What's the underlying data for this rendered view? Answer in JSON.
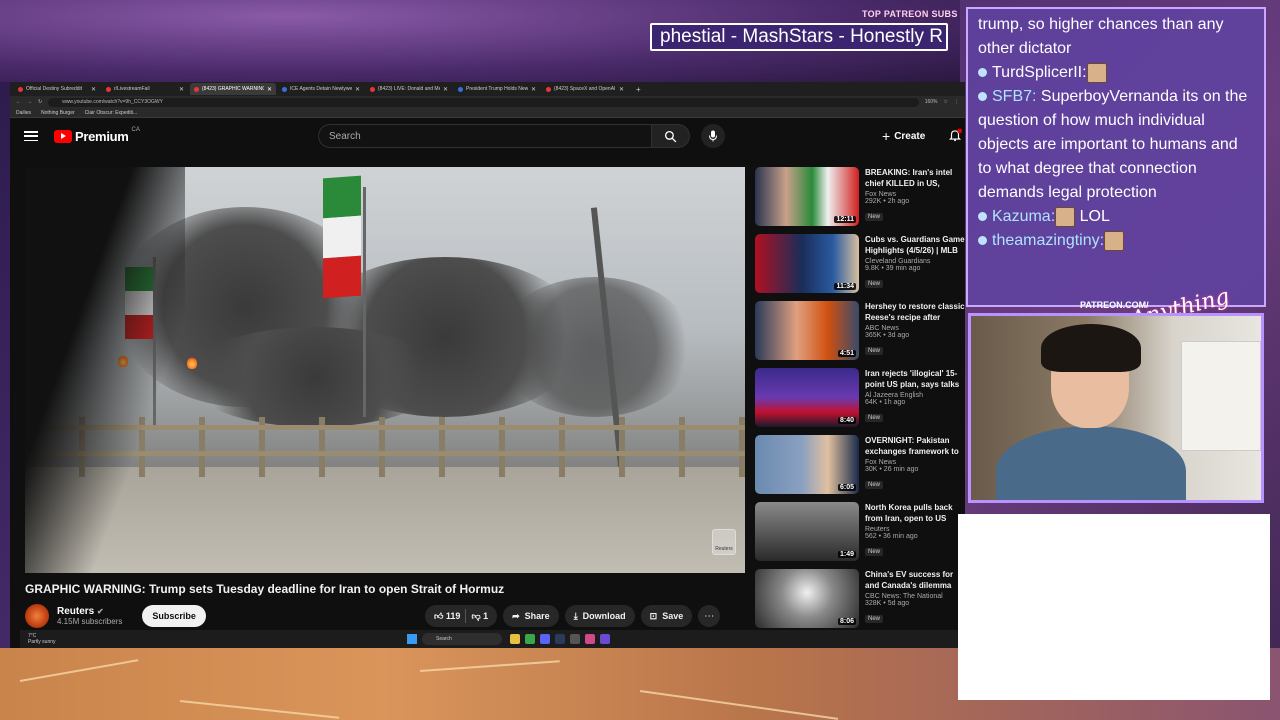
{
  "stream": {
    "patreon_label": "TOP PATREON SUBS",
    "ticker_text": "phestial - MashStars - Honestly R",
    "patreon_url": "PATREON.COM/",
    "script_logo": "Anything Else"
  },
  "browser": {
    "tabs": [
      {
        "label": "Official Destiny Subreddit",
        "active": false
      },
      {
        "label": "r/LivestreamFail",
        "active": false
      },
      {
        "label": "(8423) GRAPHIC WARNING",
        "active": true
      },
      {
        "label": "ICE Agents Detain Newlywed S",
        "active": false
      },
      {
        "label": "(8423) LIVE: Donald and Melan",
        "active": false
      },
      {
        "label": "President Trump Holds News C",
        "active": false
      },
      {
        "label": "(8423) SpaceX and OpenAI",
        "active": false
      }
    ],
    "url": "www.youtube.com/watch?v=9h_CCY3OGWY",
    "zoom": "160%",
    "bookmarks": [
      "Dailies",
      "Nothing Burger",
      "Clair Obscur: Expediti..."
    ]
  },
  "youtube": {
    "logo_text": "Premium",
    "logo_region": "CA",
    "search_placeholder": "Search",
    "create_label": "Create",
    "notification_count": "9+",
    "video_title": "GRAPHIC WARNING: Trump sets Tuesday deadline for Iran to open Strait of Hormuz",
    "channel_name": "Reuters",
    "channel_subs": "4.15M subscribers",
    "subscribe_label": "Subscribe",
    "like_count": "119",
    "dislike_count": "1",
    "share_label": "Share",
    "download_label": "Download",
    "save_label": "Save",
    "watermark": "Reuters"
  },
  "recommendations": [
    {
      "title": "BREAKING: Iran's intel chief KILLED in US, Israeli strikes",
      "source": "Fox News",
      "meta": "292K • 2h ago",
      "badge": "New",
      "duration": "12:11"
    },
    {
      "title": "Cubs vs. Guardians Game Highlights (4/5/26) | MLB",
      "source": "Cleveland Guardians",
      "meta": "9.8K • 39 min ago",
      "badge": "New",
      "duration": "11:34"
    },
    {
      "title": "Hershey to restore classic Reese's recipe after criticism",
      "source": "ABC News",
      "meta": "365K • 3d ago",
      "badge": "New",
      "duration": "4:51"
    },
    {
      "title": "Iran rejects 'illogical' 15-point US plan, says talks cannot",
      "source": "Al Jazeera English",
      "meta": "64K • 1h ago",
      "badge": "New",
      "duration": "8:40"
    },
    {
      "title": "OVERNIGHT: Pakistan exchanges framework to",
      "source": "Fox News",
      "meta": "30K • 26 min ago",
      "badge": "New",
      "duration": "6:05"
    },
    {
      "title": "North Korea pulls back from Iran, open to US talks, says",
      "source": "Reuters",
      "meta": "562 • 36 min ago",
      "badge": "New",
      "duration": "1:49"
    },
    {
      "title": "China's EV success for and Canada's dilemma",
      "source": "CBC News: The National",
      "meta": "328K • 5d ago",
      "badge": "New",
      "duration": "8:06"
    }
  ],
  "taskbar": {
    "weather_temp": "7°C",
    "weather_desc": "Partly sunny",
    "search_label": "Search"
  },
  "chat": [
    {
      "user": "",
      "text": "trump, so higher chances than any other dictator",
      "emote": false
    },
    {
      "user": "TurdSplicerII:",
      "text": "",
      "emote": true
    },
    {
      "user": "SFB7:",
      "text": "SuperboyVernanda its on the question of how much individual objects are important to humans and to what degree that connection demands legal protection",
      "emote": false
    },
    {
      "user": "Kazuma:",
      "text": "LOL",
      "emote": true
    },
    {
      "user": "theamazingtiny:",
      "text": "",
      "emote": true
    }
  ],
  "colors": {
    "yt_red": "#ff0000",
    "chat_bg": "#6042a0",
    "chat_border": "#c9a8ff",
    "username": "#aee3ff"
  }
}
